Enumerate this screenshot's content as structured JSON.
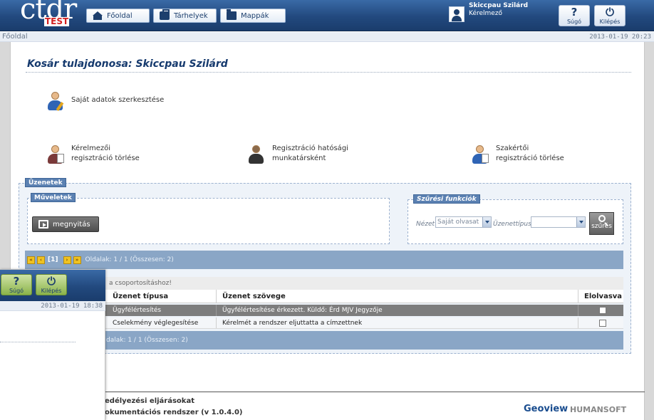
{
  "header": {
    "logo_word": "ctdr",
    "logo_badge": "TEST",
    "nav": [
      {
        "label": "Főoldal",
        "icon": "home-icon"
      },
      {
        "label": "Tárhelyek",
        "icon": "briefcase-icon"
      },
      {
        "label": "Mappák",
        "icon": "folder-icon"
      }
    ],
    "user": {
      "name": "Skiccpau Szilárd",
      "role": "Kérelmező"
    },
    "help_label": "Súgó",
    "help_glyph": "?",
    "logout_label": "Kilépés",
    "logout_glyph": "⏻"
  },
  "breadcrumb": {
    "current": "Főoldal",
    "timestamp": "2013-01-19 20:23"
  },
  "page": {
    "title": "Kosár tulajdonosa: Skiccpau Szilárd",
    "actions": [
      {
        "label_line1": "Saját adatok szerkesztése",
        "label_line2": ""
      },
      {
        "label_line1": "Kérelmezői",
        "label_line2": "regisztráció törlése"
      },
      {
        "label_line1": "Regisztráció hatósági",
        "label_line2": "munkatársként"
      },
      {
        "label_line1": "Szakértői",
        "label_line2": "regisztráció törlése"
      }
    ]
  },
  "messages": {
    "panel_title": "Üzenetek",
    "operations_title": "Műveletek",
    "open_button": "megnyitás",
    "filter_title": "Szűrési funkciók",
    "filter": {
      "view_label": "Nézet",
      "view_value": "Saját olvasat",
      "type_label": "Üzenettípus",
      "type_value": "",
      "search_button": "szűrés"
    },
    "pager": {
      "current": "[1]",
      "info": "Oldalak: 1 / 1 (Összesen: 2)"
    },
    "pager_bottom": {
      "info": "dalak: 1 / 1 (Összesen: 2)"
    },
    "group_hint": "a csoportosításhoz!",
    "columns": {
      "type": "Üzenet típusa",
      "text": "Üzenet szövege",
      "read": "Elolvasva"
    },
    "rows": [
      {
        "type": "Ügyfélértesítés",
        "text": "Ügyfélértesítése érkezett. Küldő: Érd MJV Jegyzője"
      },
      {
        "type": "Cselekmény véglegesítése",
        "text": "Kérelmét a rendszer eljuttatta a címzettnek"
      }
    ]
  },
  "footer": {
    "line1": "edélyezési eljárásokat",
    "line2": "okumentációs rendszer (v 1.0.4.0)",
    "brand1": "Geoview",
    "brand2": "HUMANSOFT"
  },
  "window2": {
    "help_label": "Súgó",
    "help_glyph": "?",
    "logout_label": "Kilépés",
    "logout_glyph": "⏻",
    "timestamp": "2013-01-19 18:38"
  },
  "colors": {
    "header_blue": "#22497e",
    "title_blue": "#163a6e",
    "row_selected": "#7d7d7d",
    "pager_blue": "#8aa6c6",
    "help_green": "#8ab34a"
  }
}
